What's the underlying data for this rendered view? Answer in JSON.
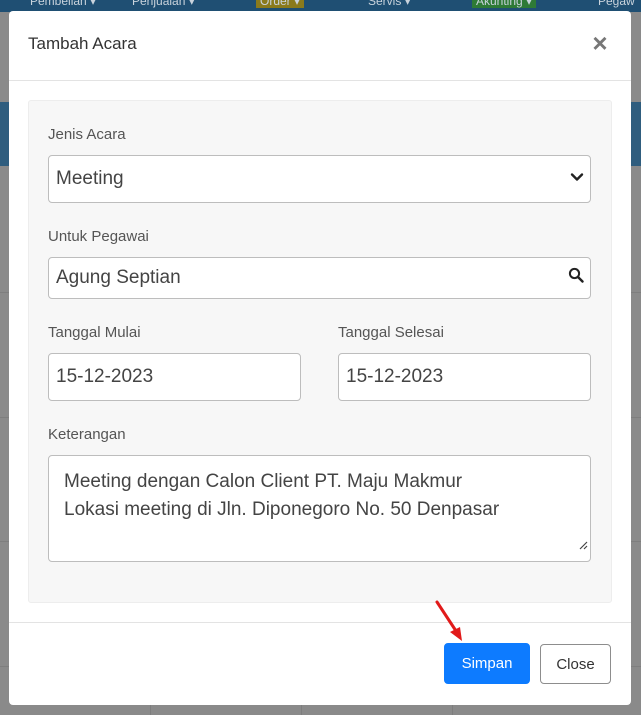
{
  "background_nav": {
    "items": [
      "Pembelian ▾",
      "Penjualan ▾",
      "Order ▾",
      "Servis ▾",
      "Akunting ▾",
      "Pegaw"
    ]
  },
  "modal": {
    "title": "Tambah Acara",
    "close_symbol": "×",
    "event_type": {
      "label": "Jenis Acara",
      "value": "Meeting",
      "icon": "chevron-down-icon"
    },
    "employee": {
      "label": "Untuk Pegawai",
      "value": "Agung Septian",
      "icon": "search-icon"
    },
    "start_date": {
      "label": "Tanggal Mulai",
      "value": "15-12-2023"
    },
    "end_date": {
      "label": "Tanggal Selesai",
      "value": "15-12-2023"
    },
    "notes": {
      "label": "Keterangan",
      "line1": "Meeting dengan Calon Client PT. Maju Makmur",
      "line2": "Lokasi meeting di Jln. Diponegoro No. 50 Denpasar"
    },
    "footer": {
      "save_label": "Simpan",
      "close_label": "Close"
    }
  },
  "colors": {
    "primary": "#0d7bff",
    "annotation_arrow": "#e11a1a",
    "overlay": "#8a8a8a"
  }
}
